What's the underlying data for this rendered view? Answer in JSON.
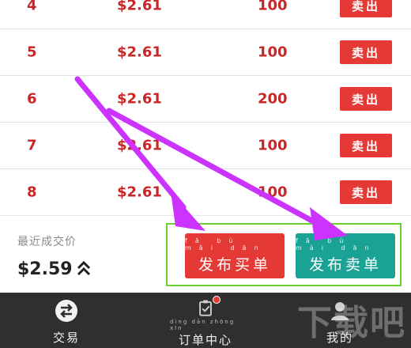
{
  "rows": [
    {
      "index": "4",
      "price": "$2.61",
      "qty": "100",
      "sell_label": "卖出"
    },
    {
      "index": "5",
      "price": "$2.61",
      "qty": "100",
      "sell_label": "卖出"
    },
    {
      "index": "6",
      "price": "$2.61",
      "qty": "200",
      "sell_label": "卖出"
    },
    {
      "index": "7",
      "price": "$2.61",
      "qty": "100",
      "sell_label": "卖出"
    },
    {
      "index": "8",
      "price": "$2.61",
      "qty": "100",
      "sell_label": "卖出"
    }
  ],
  "summary": {
    "last_label": "最近成交价",
    "last_price": "$2.59"
  },
  "actions": {
    "publish_buy_pinyin": "fā bù mǎi dān",
    "publish_buy": "发布买单",
    "publish_sell_pinyin": "fā bù mài dān",
    "publish_sell": "发布卖单"
  },
  "tabbar": {
    "trade": "交易",
    "orders_pinyin": "dìng dān zhōng xīn",
    "orders": "订单中心",
    "mine": "我的"
  },
  "watermark": "下载吧",
  "colors": {
    "red": "#e53935",
    "teal": "#1aa394",
    "highlight_frame": "#6bd12f",
    "annotation_arrow": "#cc33ff",
    "tabbar_bg": "#2f2f2f"
  },
  "icons": {
    "expand": "chevron-double-up-icon",
    "trade": "swap-arrows-icon",
    "orders": "clipboard-check-icon",
    "mine": "user-icon"
  }
}
